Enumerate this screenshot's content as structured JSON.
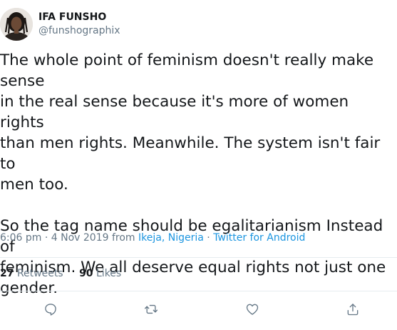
{
  "user": {
    "display_name": "IFA FUNSHO",
    "handle": "@funshographix"
  },
  "tweet": {
    "paragraphs": [
      "The whole point of feminism doesn't really make sense\nin the real sense because it's more of women rights\nthan men rights. Meanwhile. The system isn't fair to\nmen too.",
      "So the tag name should be egalitarianism Instead of\nfeminism. We all deserve equal rights not just one\ngender."
    ]
  },
  "meta": {
    "time": "6:06 pm · 4 Nov 2019 from ",
    "location": "Ikeja, Nigeria",
    "separator": " · ",
    "source": "Twitter for Android"
  },
  "stats": {
    "retweets_count": "27",
    "retweets_label": "Retweets",
    "likes_count": "90",
    "likes_label": "Likes"
  },
  "colors": {
    "text": "#14171a",
    "secondary": "#657786",
    "link": "#1b95e0",
    "divider": "#e6ecf0"
  },
  "icons": {
    "reply": "speech-bubble-icon",
    "retweet": "retweet-arrows-icon",
    "like": "heart-icon",
    "share": "share-upload-icon"
  }
}
